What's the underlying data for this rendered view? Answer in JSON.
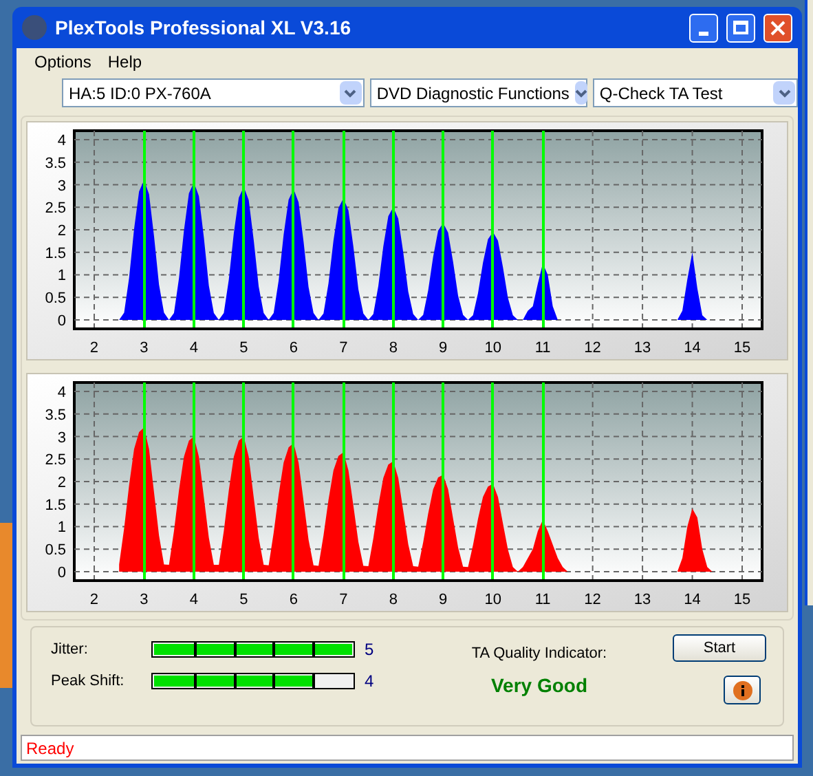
{
  "window": {
    "title": "PlexTools Professional XL V3.16"
  },
  "menu": [
    {
      "label": "Options"
    },
    {
      "label": "Help"
    }
  ],
  "dropdowns": [
    {
      "value": "HA:5 ID:0  PX-760A"
    },
    {
      "value": "DVD Diagnostic Functions"
    },
    {
      "value": "Q-Check TA Test"
    }
  ],
  "charts": [
    {
      "chart_data": {
        "type": "area",
        "grid": true,
        "xlim": [
          1.6,
          15.4
        ],
        "ylim": [
          -0.2,
          4.2
        ],
        "xticks": [
          2,
          3,
          4,
          5,
          6,
          7,
          8,
          9,
          10,
          11,
          12,
          13,
          14,
          15
        ],
        "yticks": [
          0,
          0.5,
          1,
          1.5,
          2,
          2.5,
          3,
          3.5,
          4
        ],
        "ref_lines": [
          {
            "axis": "x",
            "value": 3
          },
          {
            "axis": "x",
            "value": 4
          },
          {
            "axis": "x",
            "value": 5
          },
          {
            "axis": "x",
            "value": 6
          },
          {
            "axis": "x",
            "value": 7
          },
          {
            "axis": "x",
            "value": 8
          },
          {
            "axis": "x",
            "value": 9
          },
          {
            "axis": "x",
            "value": 10
          },
          {
            "axis": "x",
            "value": 11
          }
        ],
        "x": [
          2.5,
          2.6,
          2.7,
          2.8,
          2.9,
          3,
          3.1,
          3.2,
          3.3,
          3.4,
          3.5,
          3.6,
          3.7,
          3.8,
          3.9,
          4,
          4.1,
          4.2,
          4.3,
          4.4,
          4.5,
          4.6,
          4.7,
          4.8,
          4.9,
          5,
          5.1,
          5.2,
          5.3,
          5.4,
          5.5,
          5.6,
          5.7,
          5.8,
          5.9,
          6,
          6.1,
          6.2,
          6.3,
          6.4,
          6.5,
          6.6,
          6.7,
          6.8,
          6.9,
          7,
          7.1,
          7.2,
          7.3,
          7.4,
          7.5,
          7.6,
          7.7,
          7.8,
          7.9,
          8,
          8.1,
          8.2,
          8.3,
          8.4,
          8.5,
          8.6,
          8.7,
          8.8,
          8.9,
          9,
          9.1,
          9.2,
          9.3,
          9.4,
          9.5,
          9.6,
          9.7,
          9.8,
          9.9,
          10,
          10.1,
          10.2,
          10.3,
          10.4,
          10.5,
          10.6,
          10.7,
          10.8,
          10.9,
          11,
          11.1,
          11.2,
          11.3,
          11.4,
          11.5,
          11.6,
          11.7,
          11.8,
          11.9,
          12,
          12.1,
          12.2,
          12.3,
          12.4,
          12.5,
          12.6,
          12.7,
          12.8,
          12.9,
          13,
          13.1,
          13.2,
          13.3,
          13.4,
          13.5,
          13.6,
          13.7,
          13.8,
          13.9,
          14,
          14.1,
          14.2,
          14.3,
          14.4,
          14.5
        ],
        "series": [
          {
            "color": "#0000ff",
            "values": [
              0,
              0.16,
              0.93,
              2.02,
              2.85,
              3.1,
              2.79,
              1.86,
              0.78,
              0.16,
              0,
              0.15,
              0.92,
              1.98,
              2.81,
              3.05,
              2.75,
              1.83,
              0.76,
              0.15,
              0,
              0.15,
              0.89,
              1.92,
              2.71,
              2.95,
              2.66,
              1.77,
              0.74,
              0.15,
              0,
              0.15,
              0.87,
              1.89,
              2.67,
              2.9,
              2.61,
              1.74,
              0.73,
              0.15,
              0,
              0.14,
              0.81,
              1.76,
              2.48,
              2.7,
              2.43,
              1.62,
              0.68,
              0.14,
              0,
              0.13,
              0.75,
              1.63,
              2.3,
              2.5,
              2.25,
              1.5,
              0.63,
              0.13,
              0,
              0.11,
              0.65,
              1.4,
              1.98,
              2.15,
              1.94,
              1.29,
              0.54,
              0.11,
              0,
              0.1,
              0.59,
              1.27,
              1.79,
              1.95,
              1.76,
              1.17,
              0.49,
              0.1,
              0,
              0,
              0.2,
              0.3,
              0.8,
              1.25,
              1.0,
              0.3,
              0,
              0,
              0,
              0,
              0,
              0,
              0,
              0,
              0,
              0,
              0,
              0,
              0,
              0,
              0,
              0,
              0,
              0,
              0,
              0,
              0,
              0,
              0,
              0,
              0,
              0.2,
              0.9,
              1.5,
              0.7,
              0.1,
              0,
              0,
              0
            ]
          }
        ]
      }
    },
    {
      "chart_data": {
        "type": "area",
        "grid": true,
        "xlim": [
          1.6,
          15.4
        ],
        "ylim": [
          -0.2,
          4.2
        ],
        "xticks": [
          2,
          3,
          4,
          5,
          6,
          7,
          8,
          9,
          10,
          11,
          12,
          13,
          14,
          15
        ],
        "yticks": [
          0,
          0.5,
          1,
          1.5,
          2,
          2.5,
          3,
          3.5,
          4
        ],
        "ref_lines": [
          {
            "axis": "x",
            "value": 3
          },
          {
            "axis": "x",
            "value": 4
          },
          {
            "axis": "x",
            "value": 5
          },
          {
            "axis": "x",
            "value": 6
          },
          {
            "axis": "x",
            "value": 7
          },
          {
            "axis": "x",
            "value": 8
          },
          {
            "axis": "x",
            "value": 9
          },
          {
            "axis": "x",
            "value": 10
          },
          {
            "axis": "x",
            "value": 11
          }
        ],
        "x": [
          2.5,
          2.6,
          2.7,
          2.8,
          2.9,
          3,
          3.1,
          3.2,
          3.3,
          3.4,
          3.5,
          3.6,
          3.7,
          3.8,
          3.9,
          4,
          4.1,
          4.2,
          4.3,
          4.4,
          4.5,
          4.6,
          4.7,
          4.8,
          4.9,
          5,
          5.1,
          5.2,
          5.3,
          5.4,
          5.5,
          5.6,
          5.7,
          5.8,
          5.9,
          6,
          6.1,
          6.2,
          6.3,
          6.4,
          6.5,
          6.6,
          6.7,
          6.8,
          6.9,
          7,
          7.1,
          7.2,
          7.3,
          7.4,
          7.5,
          7.6,
          7.7,
          7.8,
          7.9,
          8,
          8.1,
          8.2,
          8.3,
          8.4,
          8.5,
          8.6,
          8.7,
          8.8,
          8.9,
          9,
          9.1,
          9.2,
          9.3,
          9.4,
          9.5,
          9.6,
          9.7,
          9.8,
          9.9,
          10,
          10.1,
          10.2,
          10.3,
          10.4,
          10.5,
          10.6,
          10.7,
          10.8,
          10.9,
          11,
          11.1,
          11.2,
          11.3,
          11.4,
          11.5,
          11.6,
          11.7,
          11.8,
          11.9,
          12,
          12.1,
          12.2,
          12.3,
          12.4,
          12.5,
          12.6,
          12.7,
          12.8,
          12.9,
          13,
          13.1,
          13.2,
          13.3,
          13.4,
          13.5,
          13.6,
          13.7,
          13.8,
          13.9,
          14,
          14.1,
          14.2,
          14.3,
          14.4,
          14.5
        ],
        "series": [
          {
            "color": "#ff0000",
            "values": [
              0.16,
              0.96,
              1.92,
              2.72,
              3.1,
              3.2,
              2.72,
              1.76,
              0.8,
              0.16,
              0.15,
              0.9,
              1.8,
              2.55,
              2.91,
              3.0,
              2.55,
              1.65,
              0.75,
              0.15,
              0.15,
              0.9,
              1.8,
              2.55,
              2.91,
              3.0,
              2.55,
              1.65,
              0.75,
              0.15,
              0.14,
              0.86,
              1.71,
              2.42,
              2.76,
              2.85,
              2.42,
              1.57,
              0.71,
              0.14,
              0.13,
              0.8,
              1.59,
              2.25,
              2.57,
              2.65,
              2.25,
              1.46,
              0.66,
              0.13,
              0.12,
              0.74,
              1.47,
              2.08,
              2.38,
              2.45,
              2.08,
              1.35,
              0.61,
              0.12,
              0.11,
              0.65,
              1.29,
              1.83,
              2.09,
              2.15,
              1.83,
              1.18,
              0.54,
              0.11,
              0.1,
              0.59,
              1.17,
              1.66,
              1.89,
              1.95,
              1.66,
              1.07,
              0.49,
              0.1,
              0,
              0.1,
              0.3,
              0.5,
              0.9,
              1.15,
              0.9,
              0.6,
              0.3,
              0.1,
              0,
              0,
              0,
              0,
              0,
              0,
              0,
              0,
              0,
              0,
              0,
              0,
              0,
              0,
              0,
              0,
              0,
              0,
              0,
              0,
              0,
              0,
              0,
              0.3,
              1.0,
              1.4,
              1.2,
              0.5,
              0.1,
              0,
              0
            ]
          }
        ]
      }
    }
  ],
  "meters": [
    {
      "label": "Jitter:",
      "level": 1,
      "reading": "5"
    },
    {
      "label": "Peak Shift:",
      "level": 0.8,
      "reading": "4"
    }
  ],
  "quality": {
    "label": "TA Quality Indicator:",
    "value": "Very Good"
  },
  "buttons": [
    {
      "kind": "text",
      "label": "Start"
    },
    {
      "kind": "info"
    }
  ],
  "status_bar": {
    "text": "Ready"
  }
}
